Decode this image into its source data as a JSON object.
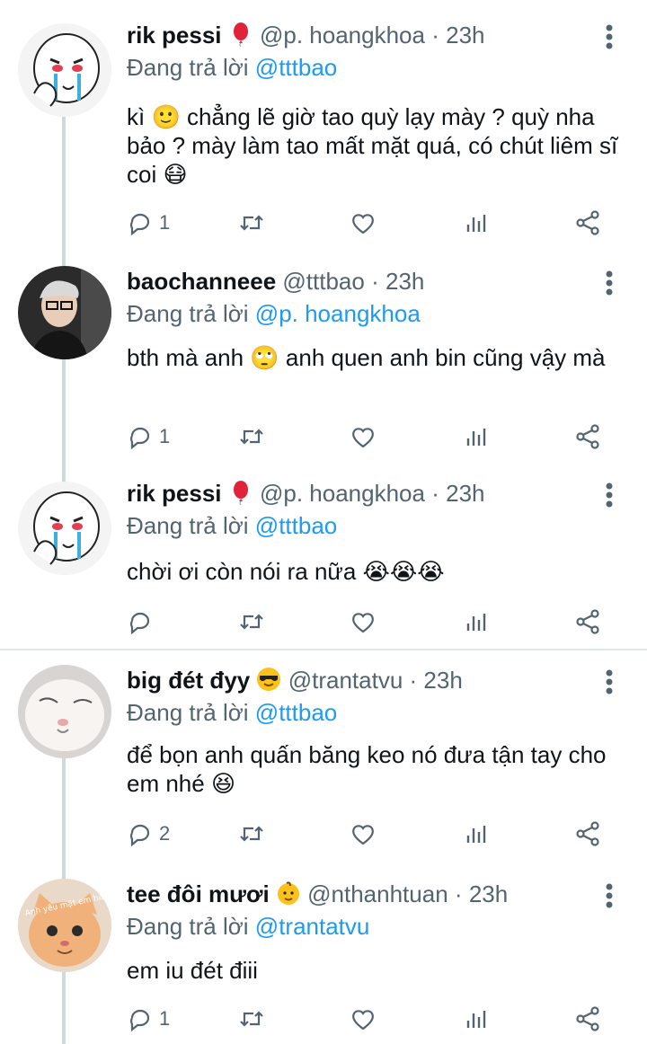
{
  "replying_prefix": "Đang trả lời",
  "tweets": [
    {
      "name": "rik pessi",
      "name_emoji": "balloon-emoji",
      "handle": "@p. hoangkhoa",
      "dot": "·",
      "time": "23h",
      "reply_to": "@tttbao",
      "text": "kì 🙂 chẳng lẽ giờ tao quỳ lạy mày ? quỳ nha bảo ? mày làm tao mất mặt quá, có chút liêm sĩ coi 😷",
      "reply_count": "1",
      "avatar": "crying-cartoon-avatar"
    },
    {
      "name": "baochanneee",
      "name_emoji": "",
      "handle": "@tttbao",
      "dot": "·",
      "time": "23h",
      "reply_to": "@p. hoangkhoa",
      "text": "bth mà anh 🙄 anh quen anh bin cũng vậy mà",
      "reply_count": "1",
      "avatar": "person-photo-avatar"
    },
    {
      "name": "rik pessi",
      "name_emoji": "balloon-emoji",
      "handle": "@p. hoangkhoa",
      "dot": "·",
      "time": "23h",
      "reply_to": "@tttbao",
      "text": "chời ơi còn nói ra nữa 😭😭😭",
      "reply_count": "",
      "avatar": "crying-cartoon-avatar"
    },
    {
      "name": "big đét đyy",
      "name_emoji": "sunglasses-emoji",
      "handle": "@trantatvu",
      "dot": "·",
      "time": "23h",
      "reply_to": "@tttbao",
      "text": "để bọn anh quấn băng keo nó đưa tận tay cho em nhé 😆",
      "reply_count": "2",
      "avatar": "white-cat-avatar"
    },
    {
      "name": "tee đôi mươi",
      "name_emoji": "baby-emoji",
      "handle": "@nthanhtuan",
      "dot": "·",
      "time": "23h",
      "reply_to": "@trantatvu",
      "text": "em iu đét điii",
      "reply_count": "1",
      "avatar": "orange-cat-avatar",
      "avatar_text": "Anh yêu mặt em hả"
    }
  ],
  "colors": {
    "accent": "#1d9bf0",
    "secondary_text": "#536471",
    "thread_line": "#cfd9de"
  }
}
